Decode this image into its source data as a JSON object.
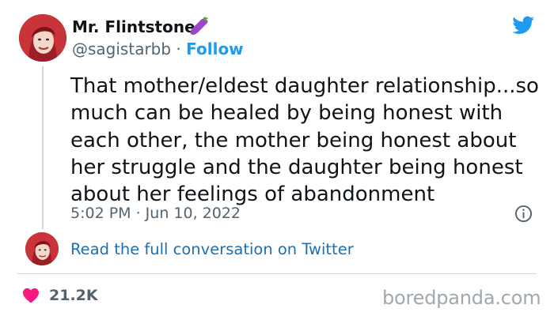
{
  "tweet": {
    "display_name": "Mr. Flintstone",
    "name_emoji_icon": "eggplant-icon",
    "handle": "@sagistarbb",
    "separator": " · ",
    "follow_label": "Follow",
    "text": "That mother/eldest daughter relationship...so much can be healed by being honest with each other, the mother being honest about her struggle and the daughter being honest about her feelings of abandonment",
    "timestamp": "5:02 PM · Jun 10, 2022",
    "conversation_link": "Read the full conversation on Twitter",
    "like_count": "21.2K"
  },
  "icons": {
    "brand": "twitter-bird-icon",
    "info": "info-icon",
    "like": "heart-icon"
  },
  "watermark": "boredpanda.com",
  "colors": {
    "twitter_blue": "#1d9bf0",
    "link_blue": "#1d6fb0",
    "heart": "#f91880",
    "muted_text": "#536471",
    "divider": "#cfd9de",
    "avatar_bg": "#c8343a"
  }
}
